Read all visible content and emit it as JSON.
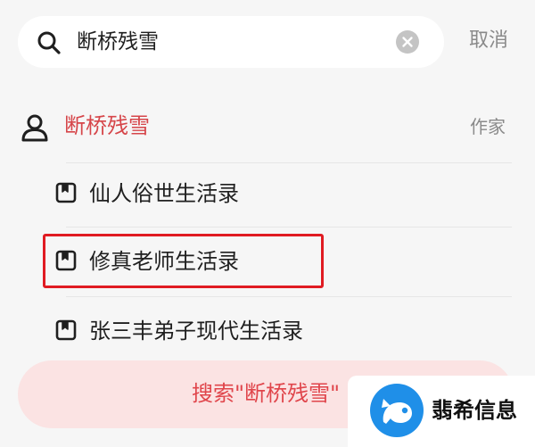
{
  "search": {
    "query": "断桥残雪",
    "cancel_label": "取消"
  },
  "author": {
    "name": "断桥残雪",
    "type_label": "作家"
  },
  "books": [
    {
      "title": "仙人俗世生活录",
      "highlighted": false
    },
    {
      "title": "修真老师生活录",
      "highlighted": true
    },
    {
      "title": "张三丰弟子现代生活录",
      "highlighted": false
    }
  ],
  "search_all_label": "搜索\"断桥残雪\"",
  "watermark": {
    "text": "翡希信息"
  },
  "colors": {
    "accent": "#d6464a",
    "highlight_border": "#e01b22",
    "search_all_bg": "#fbe3e3",
    "watermark_blue": "#1f8fe8"
  },
  "icons": {
    "search": "search-icon",
    "clear": "clear-icon",
    "person": "person-icon",
    "book": "book-icon",
    "logo": "watermark-logo-icon"
  }
}
